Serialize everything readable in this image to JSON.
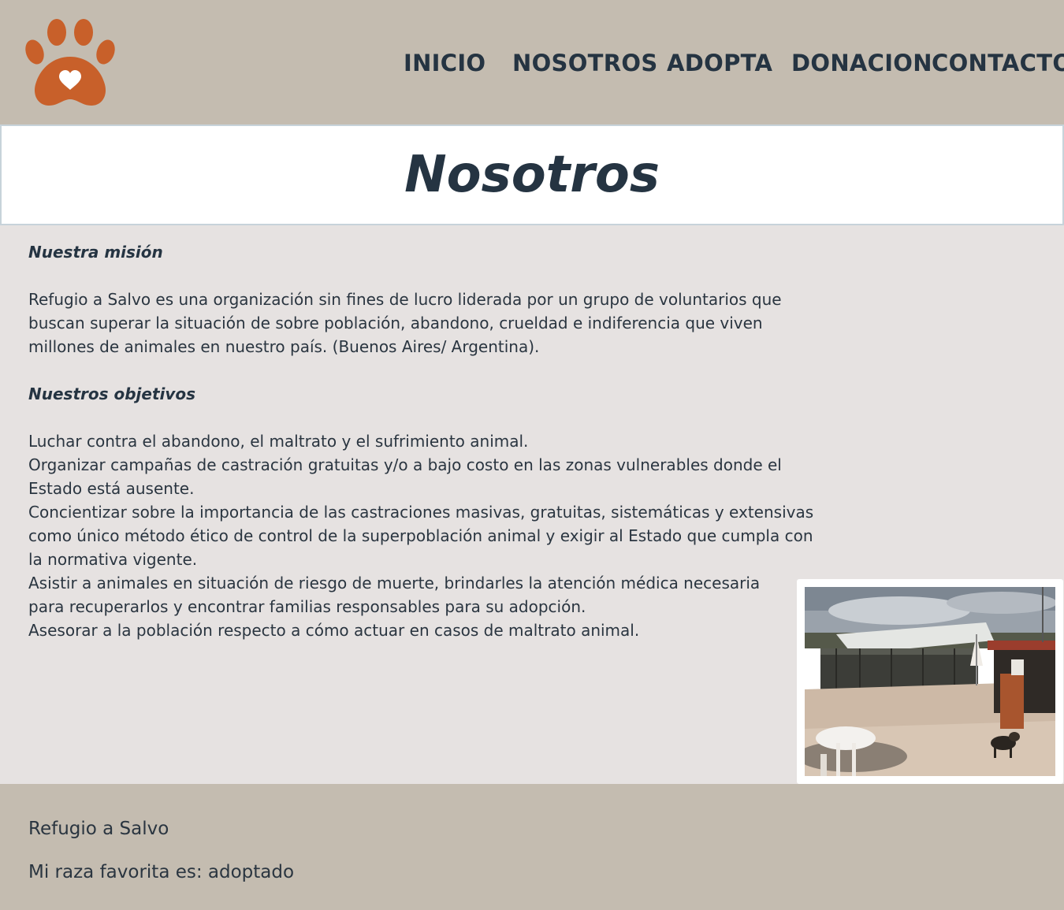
{
  "brand": {
    "logo_icon": "paw-heart-icon",
    "logo_color": "#c8602a"
  },
  "nav": {
    "items": [
      {
        "label": "INICIO"
      },
      {
        "label": "NOSOTROS"
      },
      {
        "label": "ADOPTA"
      },
      {
        "label": "DONACION"
      },
      {
        "label": "CONTACTO"
      }
    ]
  },
  "page": {
    "title": "Nosotros"
  },
  "content": {
    "mission_heading": "Nuestra misión",
    "mission_text": "Refugio a Salvo es una organización sin fines de lucro liderada por un grupo de voluntarios que buscan superar la situación de sobre población, abandono, crueldad e indiferencia que viven millones de animales en nuestro país. (Buenos Aires/ Argentina).",
    "objectives_heading": "Nuestros objetivos",
    "objectives": [
      "Luchar contra el abandono, el maltrato y el sufrimiento animal.",
      "Organizar campañas de castración gratuitas y/o a bajo costo en las zonas vulnerables donde el Estado está ausente.",
      "Concientizar sobre la importancia de las castraciones masivas, gratuitas, sistemáticas y extensivas como único método ético de control de la superpoblación animal y exigir al Estado que cumpla con la normativa vigente.",
      "Asistir a animales en situación de riesgo de muerte, brindarles la atención médica necesaria para recuperarlos y encontrar familias responsables para su adopción.",
      "Asesorar a la población respecto a cómo actuar en casos de maltrato animal."
    ]
  },
  "footer": {
    "name": "Refugio a Salvo",
    "tagline": "Mi raza favorita es: adoptado"
  },
  "colors": {
    "header_bg": "#c4bcb0",
    "body_bg": "#e6e2e1",
    "text": "#253442"
  }
}
